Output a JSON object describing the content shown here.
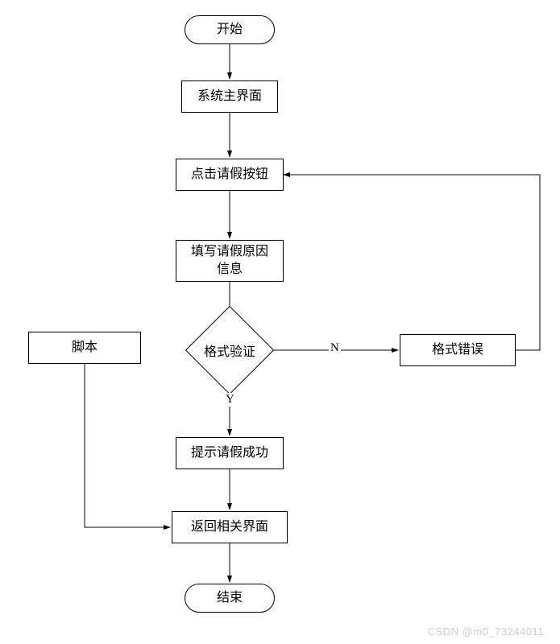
{
  "nodes": {
    "start": "开始",
    "main_ui": "系统主界面",
    "click_leave": "点击请假按钮",
    "fill_reason": "填写请假原因\n信息",
    "validate": "格式验证",
    "script": "脚本",
    "format_error": "格式错误",
    "success_tip": "提示请假成功",
    "return_ui": "返回相关界面",
    "end": "结束"
  },
  "branches": {
    "yes": "Y",
    "no": "N"
  },
  "watermark": "CSDN @m0_73244011"
}
